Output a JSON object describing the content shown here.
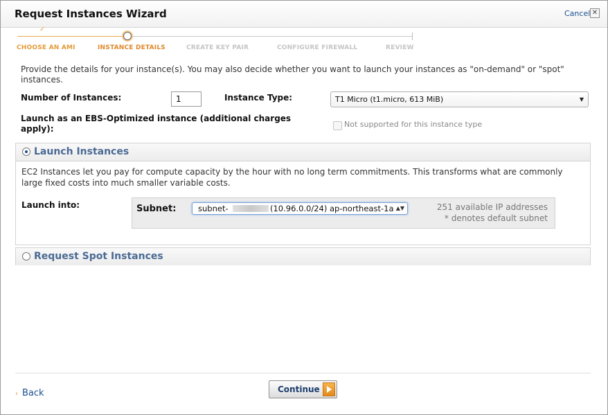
{
  "dialog": {
    "title": "Request Instances Wizard",
    "cancel_label": "Cancel",
    "close_glyph": "✕"
  },
  "wizard_steps": {
    "current_index": 1,
    "step_1": "CHOOSE AN AMI",
    "step_2": "INSTANCE DETAILS",
    "step_3": "CREATE KEY PAIR",
    "step_4": "CONFIGURE FIREWALL",
    "step_5": "REVIEW",
    "completed_glyph": "✓"
  },
  "intro_text": "Provide the details for your instance(s). You may also decide whether you want to launch your instances as \"on-demand\" or \"spot\" instances.",
  "form": {
    "num_instances_label": "Number of Instances:",
    "num_instances_value": "1",
    "instance_type_label": "Instance Type:",
    "instance_type_value": "T1 Micro (t1.micro, 613 MiB)",
    "ebs_label": "Launch as an EBS-Optimized instance (additional charges apply):",
    "ebs_note": "Not supported for this instance type",
    "ebs_checked": false
  },
  "launch_section": {
    "selected": true,
    "title": "Launch Instances",
    "description": "EC2 Instances let you pay for compute capacity by the hour with no long term commitments. This transforms what are commonly large fixed costs into much smaller variable costs.",
    "launch_into_label": "Launch into:",
    "subnet_label": "Subnet:",
    "subnet_prefix": "subnet-",
    "subnet_rest": "(10.96.0.0/24) ap-northeast-1a",
    "available_ips": "251 available IP addresses",
    "default_note": "* denotes default subnet"
  },
  "spot_section": {
    "selected": false,
    "title": "Request Spot Instances"
  },
  "footer": {
    "back_label": "Back",
    "back_glyph": "‹",
    "continue_label": "Continue"
  },
  "colors": {
    "accent_orange": "#e39a36",
    "link_blue": "#1a4f8f",
    "section_title": "#4a6a93"
  }
}
